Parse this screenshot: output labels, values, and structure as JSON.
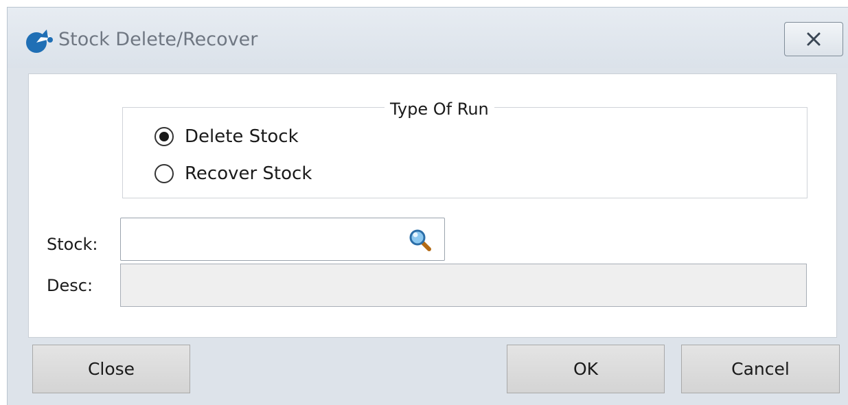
{
  "window": {
    "title": "Stock Delete/Recover",
    "icon": "app-logo-icon",
    "close_icon": "close-x-icon"
  },
  "run_group": {
    "legend": "Type Of Run",
    "options": [
      {
        "label": "Delete Stock",
        "checked": true
      },
      {
        "label": "Recover Stock",
        "checked": false
      }
    ]
  },
  "fields": {
    "stock_label": "Stock:",
    "stock_value": "",
    "stock_icon": "search-icon",
    "desc_label": "Desc:",
    "desc_value": ""
  },
  "buttons": {
    "close": "Close",
    "ok": "OK",
    "cancel": "Cancel"
  },
  "colors": {
    "titlebar": "#dde3ea",
    "logo": "#1f6fb5",
    "desc_background": "#efefef"
  }
}
